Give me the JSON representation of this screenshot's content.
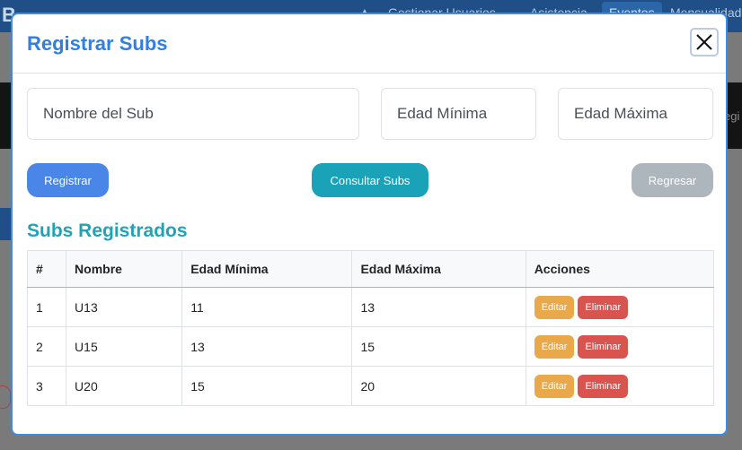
{
  "background": {
    "brand": "B",
    "nav": [
      "Gestionar Usuarios",
      "Asistencia",
      "Eventos",
      "Mensualidad"
    ],
    "right_fragment": "egi"
  },
  "modal": {
    "title": "Registrar Subs",
    "close_icon": "close-icon",
    "fields": {
      "name_placeholder": "Nombre del Sub",
      "min_age_placeholder": "Edad Mínima",
      "max_age_placeholder": "Edad Máxima"
    },
    "buttons": {
      "register": "Registrar",
      "consult": "Consultar Subs",
      "back": "Regresar"
    },
    "section_title": "Subs Registrados",
    "table": {
      "headers": [
        "#",
        "Nombre",
        "Edad Mínima",
        "Edad Máxima",
        "Acciones"
      ],
      "rows": [
        {
          "num": "1",
          "name": "U13",
          "min": "11",
          "max": "13"
        },
        {
          "num": "2",
          "name": "U15",
          "min": "13",
          "max": "15"
        },
        {
          "num": "3",
          "name": "U20",
          "min": "15",
          "max": "20"
        }
      ],
      "edit_label": "Editar",
      "delete_label": "Eliminar"
    }
  },
  "colors": {
    "title": "#2f80e0",
    "section_title": "#22a2b5",
    "register": "#4a86e8",
    "consult": "#1aa2b8",
    "back": "#adb5bd",
    "edit": "#e9a84a",
    "delete": "#d9534f"
  }
}
